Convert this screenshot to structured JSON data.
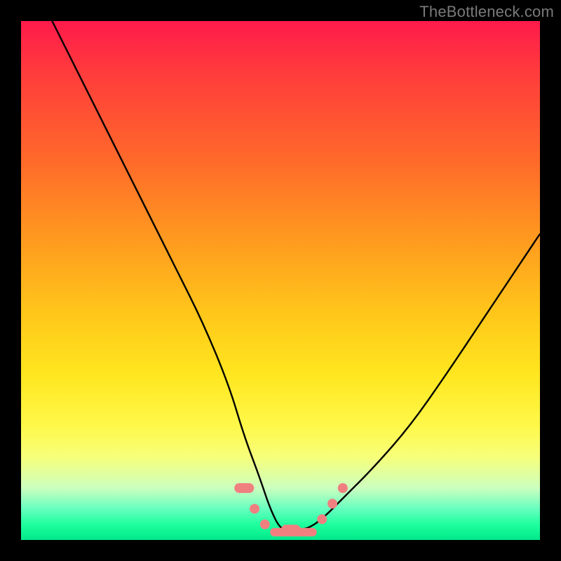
{
  "watermark": "TheBottleneck.com",
  "chart_data": {
    "type": "line",
    "title": "",
    "xlabel": "",
    "ylabel": "",
    "xlim": [
      0,
      100
    ],
    "ylim": [
      0,
      100
    ],
    "grid": false,
    "legend": false,
    "background_gradient_meaning": "top = high bottleneck (red), bottom = low bottleneck (green)",
    "series": [
      {
        "name": "bottleneck-curve",
        "x": [
          6,
          10,
          15,
          20,
          25,
          30,
          35,
          40,
          43,
          46,
          48,
          50,
          52,
          55,
          58,
          62,
          68,
          75,
          82,
          90,
          98,
          100
        ],
        "y": [
          100,
          92,
          82,
          72,
          62,
          52,
          42,
          30,
          20,
          12,
          6,
          2,
          2,
          2,
          4,
          8,
          14,
          22,
          32,
          44,
          56,
          59
        ]
      }
    ],
    "markers": [
      {
        "name": "threshold-marker",
        "x": 43,
        "y": 10,
        "shape": "pill",
        "color": "#f08080"
      },
      {
        "name": "threshold-marker",
        "x": 45,
        "y": 6,
        "shape": "round",
        "color": "#f08080"
      },
      {
        "name": "threshold-marker",
        "x": 47,
        "y": 3,
        "shape": "round",
        "color": "#f08080"
      },
      {
        "name": "threshold-marker",
        "x": 52,
        "y": 2,
        "shape": "pill",
        "color": "#f08080"
      },
      {
        "name": "threshold-marker",
        "x": 58,
        "y": 4,
        "shape": "round",
        "color": "#f08080"
      },
      {
        "name": "threshold-marker",
        "x": 60,
        "y": 7,
        "shape": "round",
        "color": "#f08080"
      },
      {
        "name": "threshold-marker",
        "x": 62,
        "y": 10,
        "shape": "round",
        "color": "#f08080"
      }
    ]
  }
}
